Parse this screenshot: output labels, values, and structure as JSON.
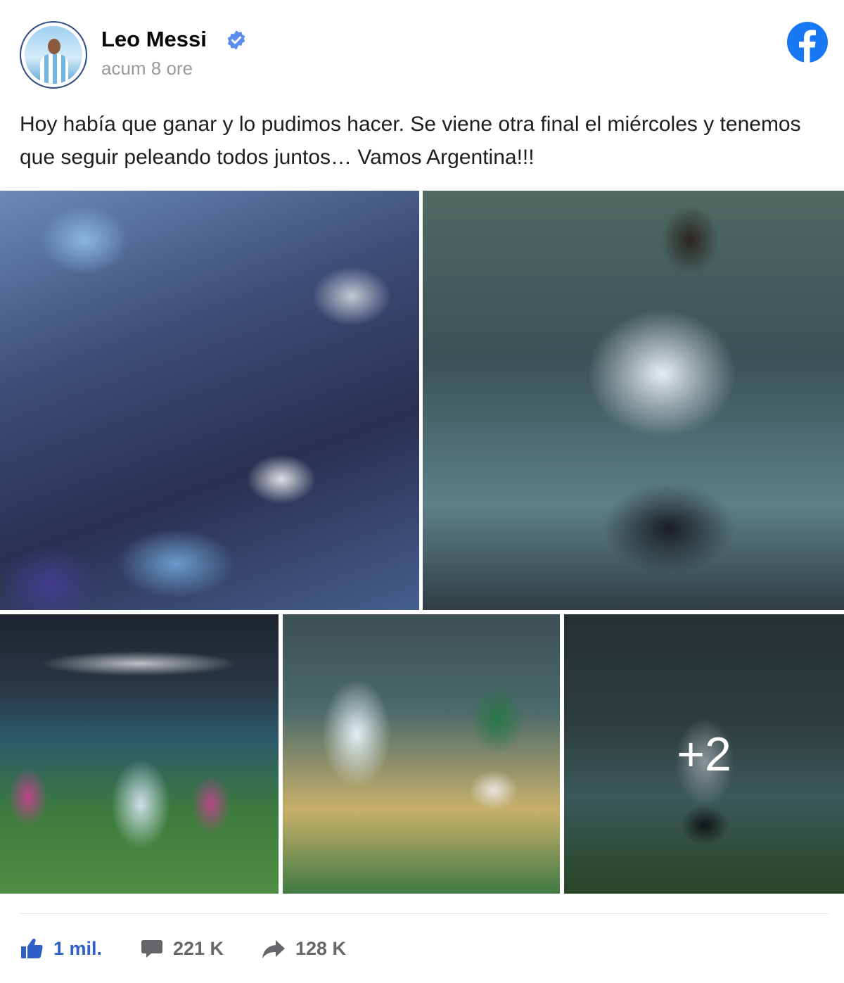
{
  "post": {
    "author": "Leo Messi",
    "timestamp": "acum 8 ore",
    "text": "Hoy había que ganar y lo pudimos hacer. Se viene otra final el miércoles y tenemos que seguir peleando todos juntos… Vamos Argentina!!!",
    "more_photos_label": "+2"
  },
  "icons": {
    "verified": "verified-badge-icon",
    "brand": "facebook-icon",
    "like": "thumbs-up-icon",
    "comment": "comment-icon",
    "share": "share-arrow-icon"
  },
  "stats": {
    "likes": "1 mil.",
    "comments": "221 K",
    "shares": "128 K"
  },
  "colors": {
    "facebook_blue": "#1877f2",
    "like_blue": "#2f5fc7",
    "muted_gray": "#65676b"
  }
}
